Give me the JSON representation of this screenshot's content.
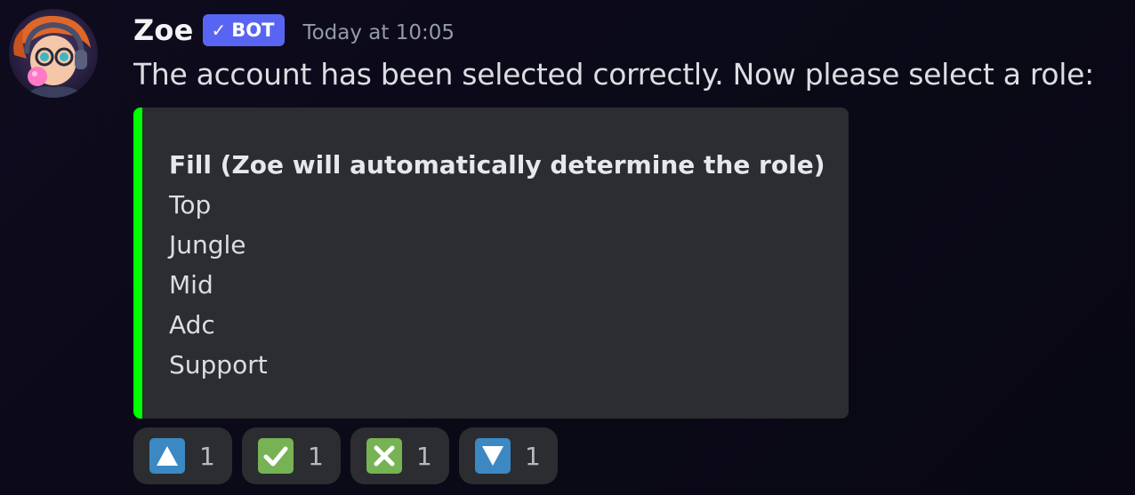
{
  "message": {
    "author": "Zoe",
    "bot_tag": "BOT",
    "bot_check_icon": "check-icon",
    "timestamp": "Today at 10:05",
    "content": "The account has been selected correctly. Now please select a role:"
  },
  "embed": {
    "accent_color": "#00ff00",
    "lines": [
      "Fill (Zoe will automatically determine the role)",
      "Top",
      "Jungle",
      "Mid",
      "Adc",
      "Support"
    ]
  },
  "reactions": [
    {
      "icon": "arrow-up-button-icon",
      "color": "#3b88c3",
      "count": "1"
    },
    {
      "icon": "white-check-mark-icon",
      "color": "#77b255",
      "count": "1"
    },
    {
      "icon": "cross-mark-button-icon",
      "color": "#77b255",
      "count": "1"
    },
    {
      "icon": "arrow-down-button-icon",
      "color": "#3b88c3",
      "count": "1"
    }
  ]
}
